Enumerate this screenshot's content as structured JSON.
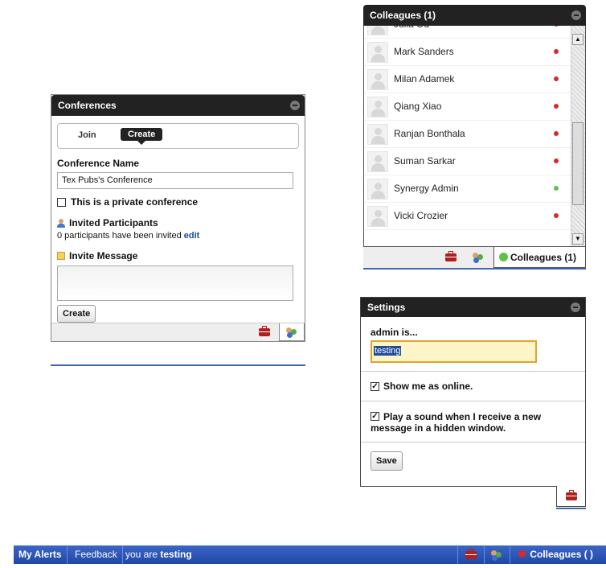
{
  "conferences": {
    "title": "Conferences",
    "tabs": {
      "join": "Join",
      "create": "Create"
    },
    "conference_name_label": "Conference Name",
    "conference_name_value": "Tex Pubs's Conference",
    "private_label": "This is a private conference",
    "invited_label": "Invited Participants",
    "invited_text": "0 participants have been invited",
    "edit_link": "edit",
    "invite_message_label": "Invite Message",
    "create_button": "Create"
  },
  "colleagues": {
    "title": "Colleagues (1)",
    "tab_label": "Colleagues (1)",
    "members": [
      {
        "name": "Julia Ou",
        "status": "offline"
      },
      {
        "name": "Mark Sanders",
        "status": "offline"
      },
      {
        "name": "Milan Adamek",
        "status": "offline"
      },
      {
        "name": "Qiang Xiao",
        "status": "offline"
      },
      {
        "name": "Ranjan Bonthala",
        "status": "offline"
      },
      {
        "name": "Suman Sarkar",
        "status": "offline"
      },
      {
        "name": "Synergy Admin",
        "status": "online"
      },
      {
        "name": "Vicki Crozier",
        "status": "offline"
      }
    ]
  },
  "settings": {
    "title": "Settings",
    "status_label": "admin is...",
    "status_value": "testing",
    "show_online_label": "Show me as online.",
    "play_sound_label": "Play a sound when I receive a new message in a hidden window.",
    "save_button": "Save"
  },
  "mainbar": {
    "my_alerts": "My Alerts",
    "feedback": "Feedback",
    "you_are_prefix": "you are",
    "you_are_user": "testing",
    "colleagues": "Colleagues ( )"
  },
  "colors": {
    "online": "#5cc24a",
    "offline": "#d42b2b",
    "bar_blue": "#2a52b4",
    "header": "#222222"
  }
}
